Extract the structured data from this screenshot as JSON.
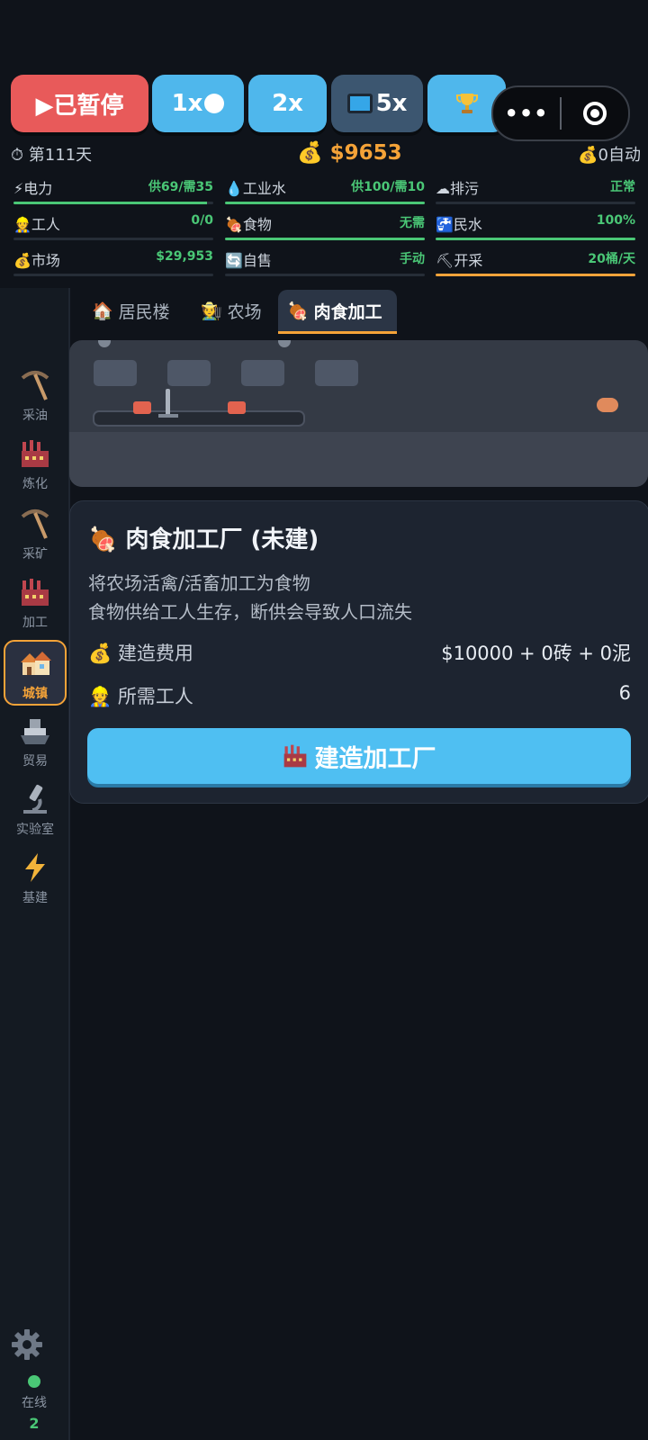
{
  "controls": {
    "pause_label": "▶已暂停",
    "speed1_label": "1x",
    "speed2_label": "2x",
    "speed5_label": "5x",
    "menu_dots": "•••"
  },
  "status": {
    "day": "第111天",
    "money": "$9653",
    "auto": "0自动"
  },
  "resources": [
    {
      "icon": "⚡",
      "label": "电力",
      "value": "供69/需35",
      "level": 0.97,
      "bar_color": "green"
    },
    {
      "icon": "💧",
      "label": "工业水",
      "value": "供100/需10",
      "level": 1.0,
      "bar_color": "green"
    },
    {
      "icon": "☁",
      "label": "排污",
      "value": "正常",
      "level": 0.0,
      "bar_color": "green"
    },
    {
      "icon": "👷",
      "label": "工人",
      "value": "0/0",
      "level": 0.0,
      "bar_color": "green"
    },
    {
      "icon": "🍖",
      "label": "食物",
      "value": "无需",
      "level": 1.0,
      "bar_color": "green"
    },
    {
      "icon": "🚰",
      "label": "民水",
      "value": "100%",
      "level": 1.0,
      "bar_color": "green"
    },
    {
      "icon": "💰",
      "label": "市场",
      "value": "$29,953",
      "level": 0.0,
      "bar_color": "green"
    },
    {
      "icon": "🔄",
      "label": "自售",
      "value": "手动",
      "level": 0.0,
      "bar_color": "green"
    },
    {
      "icon": "⛏",
      "label": "开采",
      "value": "20桶/天",
      "level": 1.0,
      "bar_color": "orange"
    }
  ],
  "sidebar": {
    "items": [
      {
        "label": "采油",
        "icon": "pickaxe-icon"
      },
      {
        "label": "炼化",
        "icon": "factory-icon"
      },
      {
        "label": "采矿",
        "icon": "pickaxe-icon"
      },
      {
        "label": "加工",
        "icon": "factory-icon"
      },
      {
        "label": "城镇",
        "icon": "houses-icon"
      },
      {
        "label": "贸易",
        "icon": "ship-icon"
      },
      {
        "label": "实验室",
        "icon": "microscope-icon"
      },
      {
        "label": "基建",
        "icon": "lightning-icon"
      }
    ],
    "active_index": 4,
    "online_label": "在线",
    "online_count": "2"
  },
  "tabs": [
    {
      "icon": "🏠",
      "label": "居民楼"
    },
    {
      "icon": "🧑‍🌾",
      "label": "农场"
    },
    {
      "icon": "🍖",
      "label": "肉食加工"
    }
  ],
  "card": {
    "title": "肉食加工厂 (未建)",
    "desc1": "将农场活禽/活畜加工为食物",
    "desc2": "食物供给工人生存，断供会导致人口流失",
    "cost_label": "建造费用",
    "cost_value": "$10000 + 0砖 + 0泥",
    "workers_label": "所需工人",
    "workers_value": "6",
    "build_button": "建造加工厂"
  },
  "colors": {
    "accent_orange": "#f5a338",
    "accent_blue": "#4fb7ec",
    "pause_red": "#e85a5a",
    "ok_green": "#4ac776"
  }
}
